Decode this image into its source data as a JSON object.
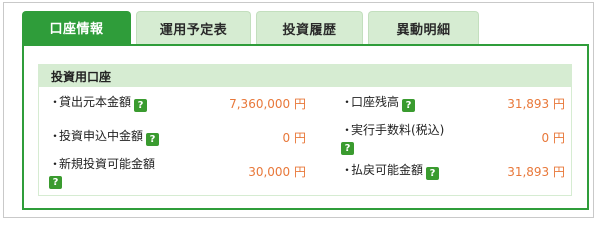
{
  "tabs": [
    {
      "label": "口座情報",
      "active": true
    },
    {
      "label": "運用予定表",
      "active": false
    },
    {
      "label": "投資履歴",
      "active": false
    },
    {
      "label": "異動明細",
      "active": false
    }
  ],
  "section": {
    "title": "投資用口座",
    "help_icon_glyph": "?",
    "rows": [
      {
        "left": {
          "label": "貸出元本金額",
          "value": "7,360,000 円"
        },
        "right": {
          "label": "口座残高",
          "value": "31,893 円"
        }
      },
      {
        "left": {
          "label": "投資申込中金額",
          "value": "0 円"
        },
        "right": {
          "label": "実行手数料(税込)",
          "value": "0 円"
        }
      },
      {
        "left": {
          "label": "新規投資可能金額",
          "value": "30,000 円"
        },
        "right": {
          "label": "払戻可能金額",
          "value": "31,893 円"
        }
      }
    ]
  },
  "colors": {
    "accent_green": "#2f9d3a",
    "tab_inactive": "#d6ecd2",
    "value_orange": "#e8783a"
  }
}
